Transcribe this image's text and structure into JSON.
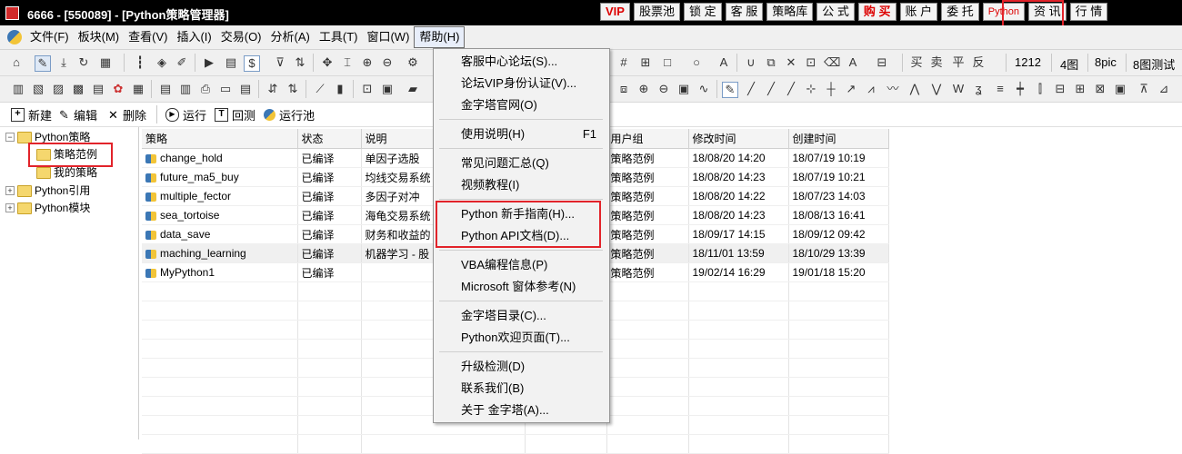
{
  "window": {
    "title": "6666 - [550089] - [Python策略管理器]"
  },
  "title_buttons": [
    "VIP",
    "股票池",
    "锁 定",
    "客 服",
    "策略库",
    "公 式",
    "购 买",
    "账 户",
    "委 托",
    "Python",
    "资 讯",
    "行 情"
  ],
  "menubar": [
    "文件(F)",
    "板块(M)",
    "查看(V)",
    "插入(I)",
    "交易(O)",
    "分析(A)",
    "工具(T)",
    "窗口(W)",
    "帮助(H)"
  ],
  "toolbar_right": [
    "1212",
    "4图",
    "8pic",
    "8图测试"
  ],
  "actions": {
    "new": "新建",
    "edit": "编辑",
    "delete": "删除",
    "run": "运行",
    "backtest": "回测",
    "run_pool": "运行池"
  },
  "tree": {
    "root": "Python策略",
    "examples": "策略范例",
    "mine": "我的策略",
    "ref": "Python引用",
    "module": "Python模块"
  },
  "table": {
    "columns": [
      "策略",
      "状态",
      "说明",
      "",
      "用户组",
      "修改时间",
      "创建时间"
    ],
    "rows": [
      [
        "change_hold",
        "已编译",
        "单因子选股",
        "",
        "策略范例",
        "18/08/20 14:20",
        "18/07/19 10:19"
      ],
      [
        "future_ma5_buy",
        "已编译",
        "均线交易系统",
        "",
        "策略范例",
        "18/08/20 14:23",
        "18/07/19 10:21"
      ],
      [
        "multiple_fector",
        "已编译",
        "多因子对冲",
        "",
        "策略范例",
        "18/08/20 14:22",
        "18/07/23 14:03"
      ],
      [
        "sea_tortoise",
        "已编译",
        "海龟交易系统",
        "",
        "策略范例",
        "18/08/20 14:23",
        "18/08/13 16:41"
      ],
      [
        "data_save",
        "已编译",
        "财务和收益的",
        "",
        "策略范例",
        "18/09/17 14:15",
        "18/09/12 09:42"
      ],
      [
        "maching_learning",
        "已编译",
        "机器学习 - 股",
        "",
        "策略范例",
        "18/11/01 13:59",
        "18/10/29 13:39"
      ],
      [
        "MyPython1",
        "已编译",
        "",
        "",
        "策略范例",
        "19/02/14 16:29",
        "19/01/18 15:20"
      ]
    ]
  },
  "help_menu": {
    "items": [
      {
        "label": "客服中心论坛(S)...",
        "shortcut": ""
      },
      {
        "label": "论坛VIP身份认证(V)...",
        "shortcut": ""
      },
      {
        "label": "金字塔官网(O)",
        "shortcut": ""
      },
      {
        "label": "使用说明(H)",
        "shortcut": "F1"
      },
      {
        "label": "常见问题汇总(Q)",
        "shortcut": ""
      },
      {
        "label": "视频教程(I)",
        "shortcut": ""
      },
      {
        "label": "Python 新手指南(H)...",
        "shortcut": ""
      },
      {
        "label": "Python API文档(D)...",
        "shortcut": ""
      },
      {
        "label": "VBA编程信息(P)",
        "shortcut": ""
      },
      {
        "label": "Microsoft 窗体参考(N)",
        "shortcut": ""
      },
      {
        "label": "金字塔目录(C)...",
        "shortcut": ""
      },
      {
        "label": "Python欢迎页面(T)...",
        "shortcut": ""
      },
      {
        "label": "升级检测(D)",
        "shortcut": ""
      },
      {
        "label": "联系我们(B)",
        "shortcut": ""
      },
      {
        "label": "关于 金字塔(A)...",
        "shortcut": ""
      }
    ]
  },
  "colors": {
    "highlight": "#e2232a",
    "titlebar": "#000000"
  }
}
